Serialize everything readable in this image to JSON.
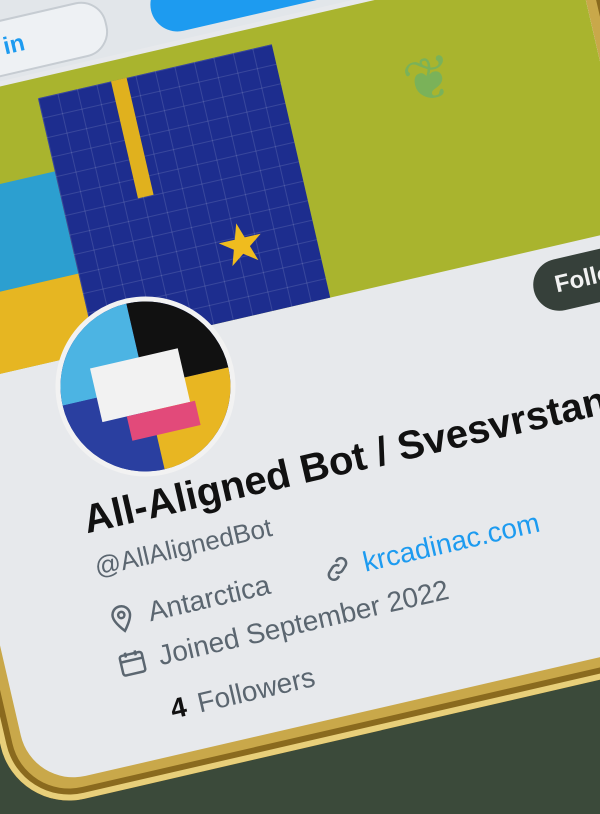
{
  "header": {
    "login_label": "og in"
  },
  "profile": {
    "display_name": "All-Aligned Bot / Svesvrstani bot",
    "handle": "@AllAlignedBot",
    "location": "Antarctica",
    "website": "krcadinac.com",
    "joined": "Joined September 2022",
    "following_count": "",
    "followers_count": "4",
    "followers_label": "Followers",
    "follow_button": "Follow"
  },
  "icons": {
    "location": "map-pin-icon",
    "website": "link-icon",
    "joined": "calendar-icon"
  },
  "colors": {
    "accent": "#1d9bf0",
    "follow_bg": "#36403a",
    "frame": "#c9a84a"
  }
}
